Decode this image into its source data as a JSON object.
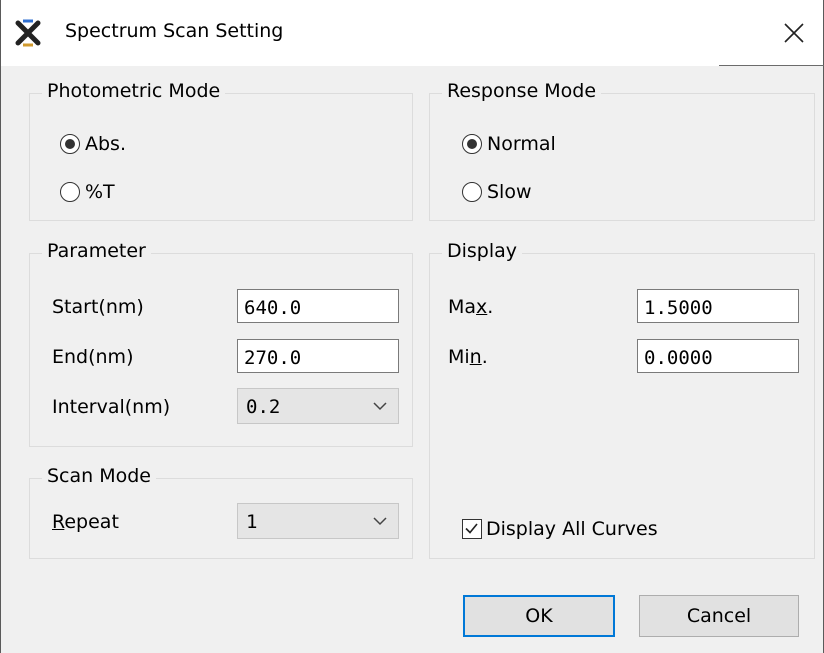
{
  "window": {
    "title": "Spectrum Scan Setting"
  },
  "photometric_mode": {
    "legend": "Photometric Mode",
    "options": [
      {
        "label": "Abs.",
        "selected": true
      },
      {
        "label": "%T",
        "selected": false
      }
    ]
  },
  "response_mode": {
    "legend": "Response Mode",
    "options": [
      {
        "label": "Normal",
        "selected": true
      },
      {
        "label": "Slow",
        "selected": false
      }
    ]
  },
  "parameter": {
    "legend": "Parameter",
    "start_label": "Start(nm)",
    "start_value": "640.0",
    "end_label": "End(nm)",
    "end_value": "270.0",
    "interval_label": "Interval(nm)",
    "interval_value": "0.2"
  },
  "display": {
    "legend": "Display",
    "max_label_prefix": "Ma",
    "max_label_mnemonic": "x",
    "max_label_suffix": ".",
    "max_value": "1.5000",
    "min_label_prefix": "Mi",
    "min_label_mnemonic": "n",
    "min_label_suffix": ".",
    "min_value": "0.0000",
    "display_all_label": "Display All Curves",
    "display_all_checked": true
  },
  "scan_mode": {
    "legend": "Scan Mode",
    "repeat_label_mnemonic": "R",
    "repeat_label_rest": "epeat",
    "repeat_value": "1"
  },
  "buttons": {
    "ok": "OK",
    "cancel": "Cancel"
  },
  "icons": {
    "app": "x-cross-app-icon",
    "close": "close-icon",
    "dropdown": "chevron-down-icon",
    "check": "checkmark-icon"
  },
  "colors": {
    "default_button_border": "#0078d7",
    "dialog_background": "#f0f0f0"
  }
}
